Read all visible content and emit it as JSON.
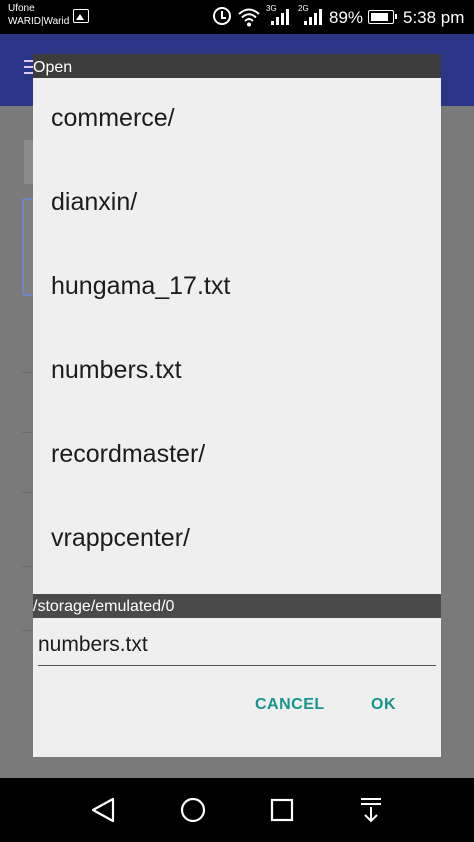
{
  "status_bar": {
    "carrier_primary": "Ufone",
    "carrier_secondary": "WARID|Warid",
    "network_1": "3G",
    "network_2": "2G",
    "battery_percent": "89%",
    "battery_level": 0.89,
    "time": "5:38 pm"
  },
  "dialog": {
    "title": "Open",
    "files": [
      "commerce/",
      "dianxin/",
      "hungama_17.txt",
      "numbers.txt",
      "recordmaster/",
      "vrappcenter/"
    ],
    "current_path": "/storage/emulated/0",
    "filename_value": "numbers.txt",
    "cancel_label": "CANCEL",
    "ok_label": "OK"
  },
  "icons": {
    "status": [
      "gallery-icon",
      "alarm-icon",
      "wifi-icon",
      "signal-icon",
      "battery-icon"
    ],
    "navigation": [
      "back-icon",
      "home-icon",
      "recents-icon",
      "notification-pull-icon"
    ]
  },
  "colors": {
    "accent": "#17958c",
    "toolbar": "#2b3587",
    "dialog_background": "#efefef",
    "title_bar": "#3c3c3c"
  }
}
